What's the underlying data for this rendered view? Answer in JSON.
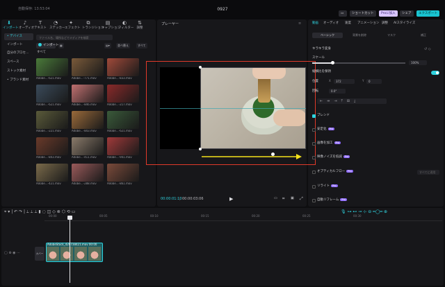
{
  "titlebar": {
    "autosave": "自動保存: 13:53:04",
    "project_title": "0927",
    "shortcut_label": "ショートカット",
    "pro_label": "Proに加入",
    "share_label": "シェア",
    "export_label": "エクスポート"
  },
  "toolbar": [
    {
      "label": "インポート",
      "icon": "import-icon"
    },
    {
      "label": "オーディオ",
      "icon": "audio-icon"
    },
    {
      "label": "テキスト",
      "icon": "text-icon"
    },
    {
      "label": "ステッカー",
      "icon": "sticker-icon"
    },
    {
      "label": "エフェクト",
      "icon": "effect-icon"
    },
    {
      "label": "トランジション",
      "icon": "transition-icon"
    },
    {
      "label": "キャプション",
      "icon": "caption-icon"
    },
    {
      "label": "フィルター",
      "icon": "filter-icon"
    },
    {
      "label": "調整",
      "icon": "adjust-icon"
    }
  ],
  "sidebar": {
    "items": [
      "• デバイス",
      "インポート",
      "自分のプロセ…",
      "スペース",
      "ストック素材",
      "• ブランド素材"
    ]
  },
  "media": {
    "search_placeholder": "ファイル名、場所などでメディアを検索",
    "import_label": "インポート",
    "sort_label": "並べ替え",
    "all_label": "すべて",
    "section_label": "すべて",
    "items": [
      {
        "name": "Adobe…-621.mov",
        "color": "#4a7a3a"
      },
      {
        "name": "Adobe…-771.mov",
        "color": "#7a5a3a"
      },
      {
        "name": "Adobe…-833.mov",
        "color": "#a04a3a"
      },
      {
        "name": "Adobe…-621.mov",
        "color": "#3a4a5a"
      },
      {
        "name": "Adobe…-846.mov",
        "color": "#c07070"
      },
      {
        "name": "Adobe…-217.mov",
        "color": "#8a2a2a"
      },
      {
        "name": "Adobe…-221.mov",
        "color": "#5a5a3a"
      },
      {
        "name": "Adobe…-843.mov",
        "color": "#9a6a3a"
      },
      {
        "name": "Adobe…-621.mov",
        "color": "#3a5a3a"
      },
      {
        "name": "Adobe…-843.mov",
        "color": "#6a3a2a"
      },
      {
        "name": "Adobe…-411.mov",
        "color": "#8a7a6a"
      },
      {
        "name": "Adobe…-941.mov",
        "color": "#a03a3a"
      },
      {
        "name": "Adobe…-421.mov",
        "color": "#7a6a4a"
      },
      {
        "name": "Adobe…-288.mov",
        "color": "#9a5a5a"
      },
      {
        "name": "Adobe…-861.mov",
        "color": "#7a4a3a"
      }
    ]
  },
  "player": {
    "title": "プレーヤー",
    "time_current": "00:00:01:10",
    "time_total": "00:00:03:06"
  },
  "right": {
    "tabs": [
      "動画",
      "オーディオ",
      "速度",
      "アニメーション",
      "調整",
      "AIスタイライズ"
    ],
    "subtabs": [
      "ベーシック",
      "背景を削除",
      "マスク",
      "補正"
    ],
    "section_title": "キラキラ変身",
    "scale_label": "スケール",
    "scale_value": "100%",
    "scale_fraction": 0.22,
    "uniform_label": "縦横比を保持",
    "position_label": "位置",
    "pos_x": "372",
    "pos_y": "0",
    "rotate_label": "回転",
    "rotate_value": "0.0°",
    "blend_label": "ブレンド",
    "stabilize_label": "安定化",
    "enhance_label": "画像を加工",
    "denoise_label": "映像ノイズを低減",
    "optical_label": "オプティカルフロー",
    "optical_right": "すべてに適用",
    "relight_label": "リライト",
    "autoframe_label": "自動リフレーム",
    "pro_badge": "Pro"
  },
  "timeline": {
    "ticks": [
      "00:00",
      "00:05",
      "00:10",
      "00:15",
      "00:20",
      "00:25",
      "00:30"
    ],
    "clip_label": "AdobeStock_426738421.mov",
    "clip_duration": "00:00",
    "cover_label": "カバー"
  }
}
